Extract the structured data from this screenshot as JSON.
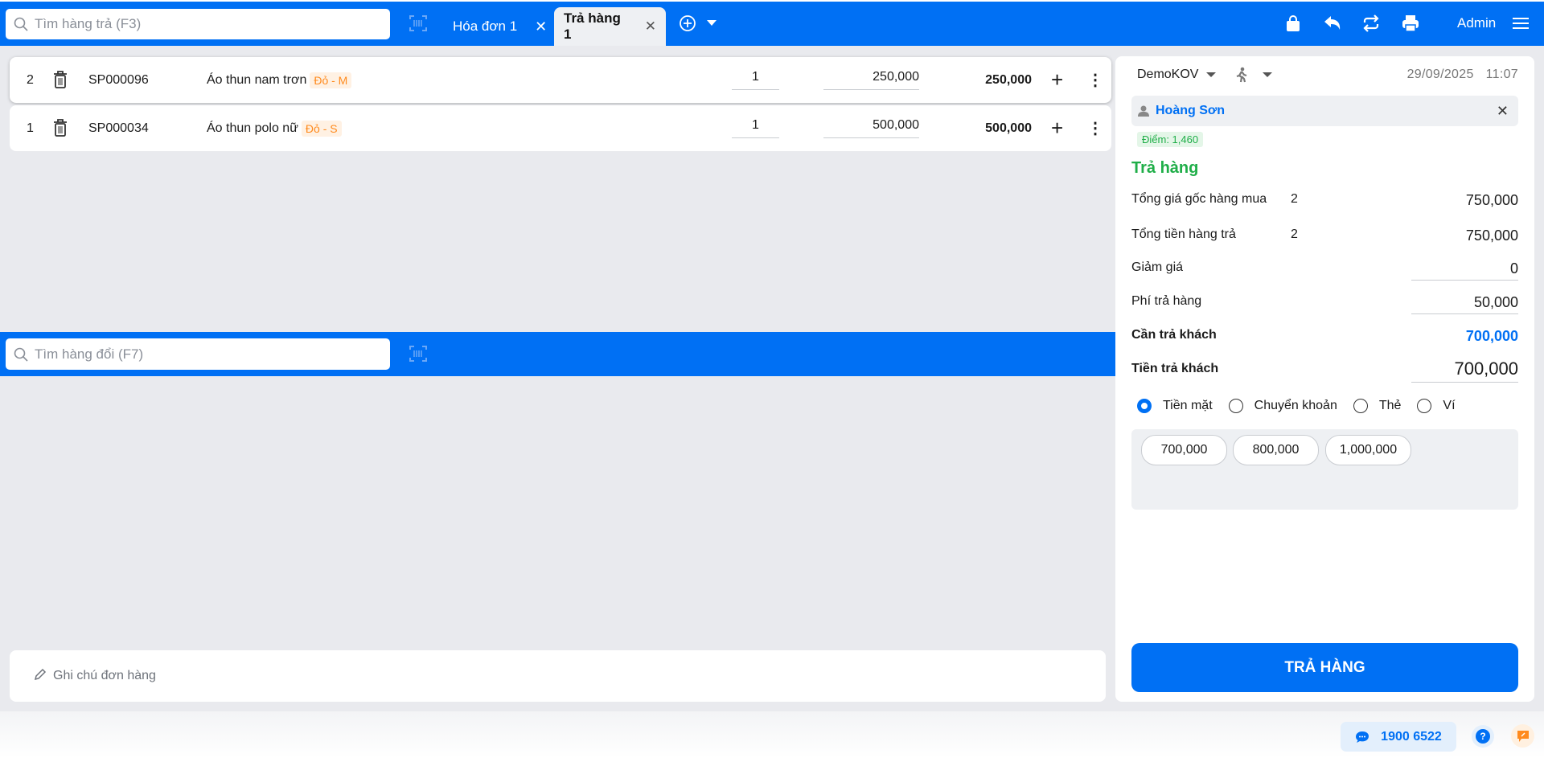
{
  "topbar": {
    "search_placeholder": "Tìm hàng trả (F3)",
    "tabs": [
      {
        "label": "Hóa đơn 1",
        "active": false
      },
      {
        "label": "Trả hàng 1",
        "active": true
      }
    ],
    "user": "Admin"
  },
  "items": [
    {
      "index": "2",
      "code": "SP000096",
      "name": "Áo thun nam trơn",
      "variant": "Đỏ - M",
      "qty": "1",
      "price": "250,000",
      "total": "250,000"
    },
    {
      "index": "1",
      "code": "SP000034",
      "name": "Áo thun polo nữ",
      "variant": "Đỏ - S",
      "qty": "1",
      "price": "500,000",
      "total": "500,000"
    }
  ],
  "exchange": {
    "search_placeholder": "Tìm hàng đổi (F7)"
  },
  "note": {
    "placeholder": "Ghi chú đơn hàng"
  },
  "panel": {
    "branch": "DemoKOV",
    "date": "29/09/2025",
    "time": "11:07",
    "customer": "Hoàng Sơn",
    "points": "Điểm: 1,460",
    "section_title": "Trả hàng",
    "rows": [
      {
        "label": "Tổng giá gốc hàng mua",
        "count": "2",
        "value": "750,000"
      },
      {
        "label": "Tổng tiền hàng trả",
        "count": "2",
        "value": "750,000"
      },
      {
        "label": "Giảm giá",
        "value": "0"
      },
      {
        "label": "Phí trả hàng",
        "value": "50,000"
      },
      {
        "label": "Cần trả khách",
        "value": "700,000"
      },
      {
        "label": "Tiền trả khách",
        "value": "700,000"
      }
    ],
    "payment_methods": [
      {
        "label": "Tiền mặt",
        "selected": true
      },
      {
        "label": "Chuyển khoản",
        "selected": false
      },
      {
        "label": "Thẻ",
        "selected": false
      },
      {
        "label": "Ví",
        "selected": false
      }
    ],
    "quick_amounts": [
      "700,000",
      "800,000",
      "1,000,000"
    ],
    "submit": "TRẢ HÀNG"
  },
  "footer": {
    "hotline": "1900 6522"
  },
  "colors": {
    "primary": "#0070f4",
    "green": "#1fae48",
    "orange": "#ff8a1d"
  }
}
